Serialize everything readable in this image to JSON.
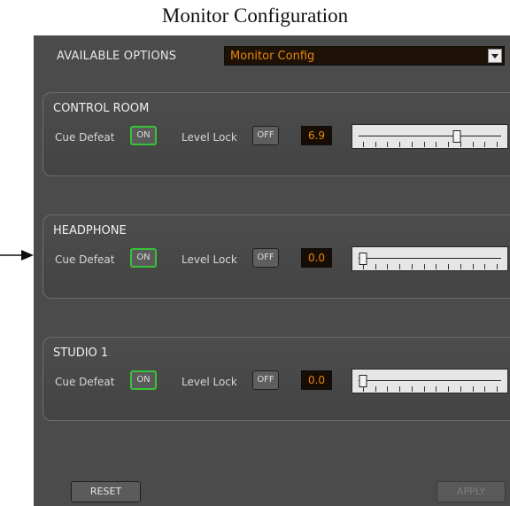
{
  "page_title": "Monitor Configuration",
  "available_options": {
    "label": "AVAILABLE OPTIONS",
    "selected": "Monitor Config"
  },
  "sections": [
    {
      "title": "CONTROL ROOM",
      "cue_defeat_label": "Cue Defeat",
      "cue_defeat_state": "ON",
      "level_lock_label": "Level Lock",
      "level_lock_state": "OFF",
      "level_value": "6.9",
      "slider_fraction": 0.7
    },
    {
      "title": "HEADPHONE",
      "cue_defeat_label": "Cue Defeat",
      "cue_defeat_state": "ON",
      "level_lock_label": "Level Lock",
      "level_lock_state": "OFF",
      "level_value": "0.0",
      "slider_fraction": 0.0
    },
    {
      "title": "STUDIO 1",
      "cue_defeat_label": "Cue Defeat",
      "cue_defeat_state": "ON",
      "level_lock_label": "Level Lock",
      "level_lock_state": "OFF",
      "level_value": "0.0",
      "slider_fraction": 0.0
    }
  ],
  "buttons": {
    "reset": "RESET",
    "apply": "APPLY"
  },
  "colors": {
    "accent": "#e8860e",
    "on_border": "#37c337"
  }
}
